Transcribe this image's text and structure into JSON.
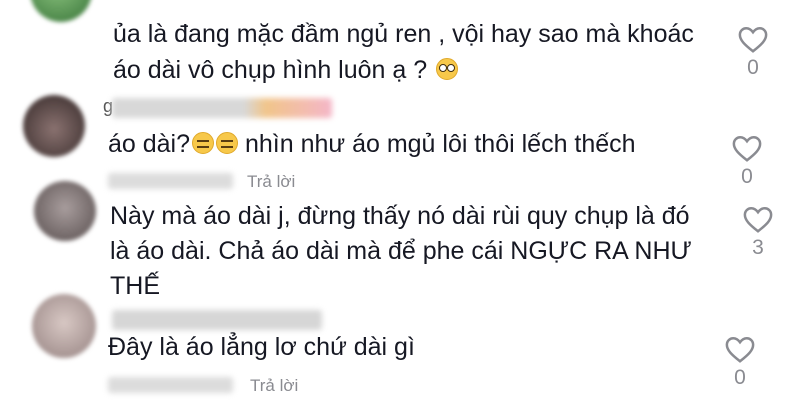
{
  "comments": [
    {
      "text_line1": "ủa là đang mặc đầm ngủ ren , vội hay sao mà khoác",
      "text_line2": "áo dài vô chụp hình luôn ạ ?",
      "emoji": "flushed-face-icon",
      "likes": "0",
      "avatar_color": "#6fa86a"
    },
    {
      "username_prefix": "g",
      "text_line1": "áo dài?",
      "text_line1_after": " nhìn như áo mgủ lôi thôi lếch thếch",
      "emoji": "expressionless-face-icon",
      "reply_label": "Trả lời",
      "likes": "0",
      "avatar_color": "#6b5a58"
    },
    {
      "text_line1": "Này mà áo dài j, đừng thấy nó dài rùi quy chụp là đó",
      "text_line2": "là áo dài. Chả áo dài mà để phe cái NGỰC RA NHƯ",
      "text_line3": "THẾ",
      "likes": "3",
      "avatar_color": "#8e8484"
    },
    {
      "text_line1": "Đây là áo lẳng lơ chứ dài gì",
      "reply_label": "Trả lời",
      "likes": "0",
      "avatar_color": "#b7a7a4"
    }
  ],
  "colors": {
    "text": "#161823",
    "muted": "#8a8b91",
    "heart_stroke": "#8a8b91"
  }
}
